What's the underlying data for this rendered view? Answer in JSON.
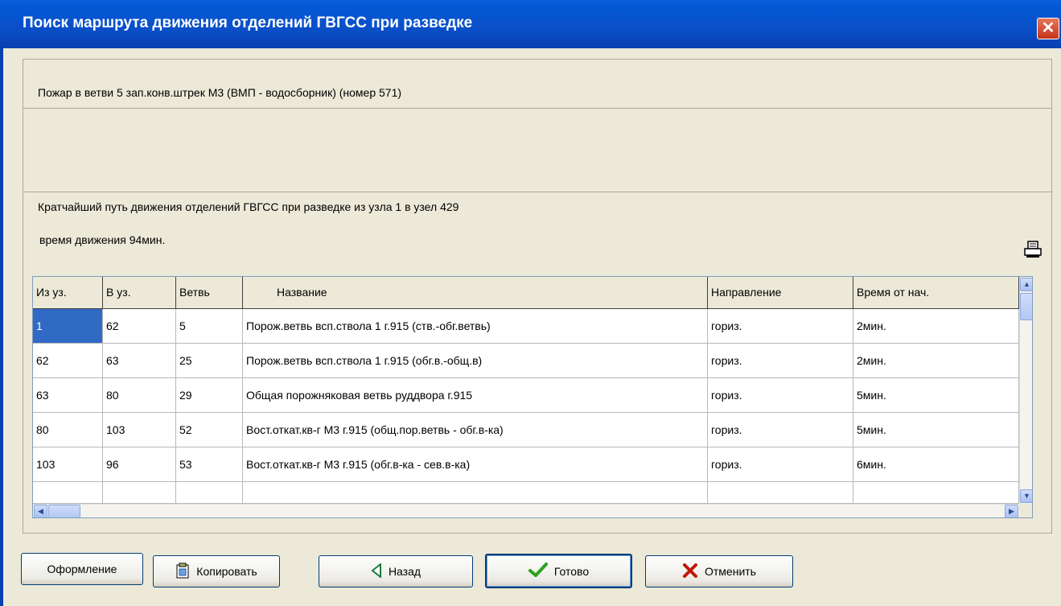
{
  "window": {
    "title": "Поиск маршрута движения отделений ГВГСС при разведке"
  },
  "fire_text": "Пожар в ветви 5 зап.конв.штрек М3 (ВМП - водосборник) (номер 571)",
  "path_text": "Кратчайший путь движения отделений ГВГСС при разведке из узла  1  в узел  429",
  "time_text": "время движения 94мин.",
  "table": {
    "columns": [
      "Из уз.",
      "В уз.",
      "Ветвь",
      "Название",
      "Направление",
      "Время от нач."
    ],
    "rows": [
      [
        "1",
        "62",
        "5",
        "Порож.ветвь всп.ствола 1 г.915 (ств.-обг.ветвь)",
        "гориз.",
        "2мин."
      ],
      [
        "62",
        "63",
        "25",
        "Порож.ветвь всп.ствола 1 г.915 (обг.в.-общ.в)",
        "гориз.",
        "2мин."
      ],
      [
        "63",
        "80",
        "29",
        "Общая порожняковая ветвь руддвора г.915",
        "гориз.",
        "5мин."
      ],
      [
        "80",
        "103",
        "52",
        "Вост.откат.кв-г М3 г.915 (общ.пор.ветвь - обг.в-ка)",
        "гориз.",
        "5мин."
      ],
      [
        "103",
        "96",
        "53",
        "Вост.откат.кв-г М3 г.915 (обг.в-ка - сев.в-ка)",
        "гориз.",
        "6мин."
      ]
    ]
  },
  "buttons": {
    "design": "Оформление",
    "copy": "Копировать",
    "back": "Назад",
    "done": "Готово",
    "cancel": "Отменить"
  },
  "icons": {
    "close": "close-icon",
    "print": "printer-icon",
    "copy": "clipboard-icon",
    "back": "triangle-left-icon",
    "done": "checkmark-icon",
    "cancel": "x-icon"
  },
  "colors": {
    "titlebar": "#0458d6",
    "selection": "#316ac5",
    "done_check": "#2aa31a",
    "cancel_x": "#c0180c",
    "back_triangle": "#1a7a3a"
  }
}
